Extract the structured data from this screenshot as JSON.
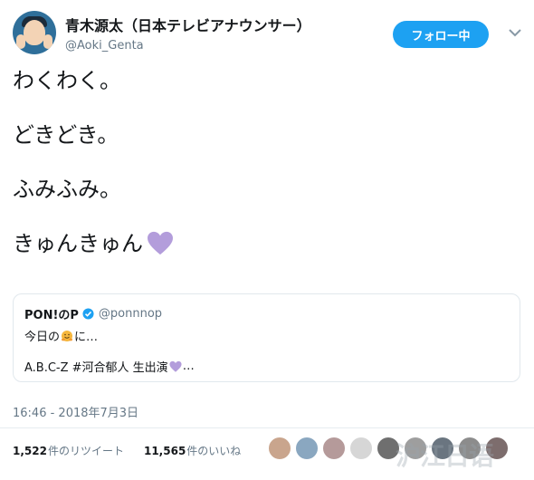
{
  "user": {
    "display_name": "青木源太（日本テレビアナウンサー）",
    "handle": "@Aoki_Genta"
  },
  "follow_button": {
    "label": "フォロー中"
  },
  "tweet": {
    "lines": [
      "わくわく。",
      "どきどき。",
      "ふみふみ。",
      "きゅんきゅん"
    ],
    "heart_color": "#b39ddb"
  },
  "quote": {
    "name": "PON!のP",
    "handle": "@ponnnop",
    "line1_a": "今日の",
    "line1_b": "に…",
    "line2": "A.B.C-Z #河合郁人 生出演",
    "line2_tail": "…"
  },
  "timestamp": "16:46 - 2018年7月3日",
  "stats": {
    "retweets_num": "1,522",
    "retweets_label": "件のリツイート",
    "likes_num": "11,565",
    "likes_label": "件のいいね"
  },
  "likers_colors": [
    "#c9a58d",
    "#8aa7c0",
    "#b59a9a",
    "#d6d6d6",
    "#6f6f6f",
    "#9e9e9e",
    "#6a7580",
    "#8c8c8c",
    "#7d6d6d"
  ],
  "watermark": "沪江日语",
  "colors": {
    "accent": "#1da1f2",
    "text": "#14171a",
    "muted": "#657786"
  }
}
